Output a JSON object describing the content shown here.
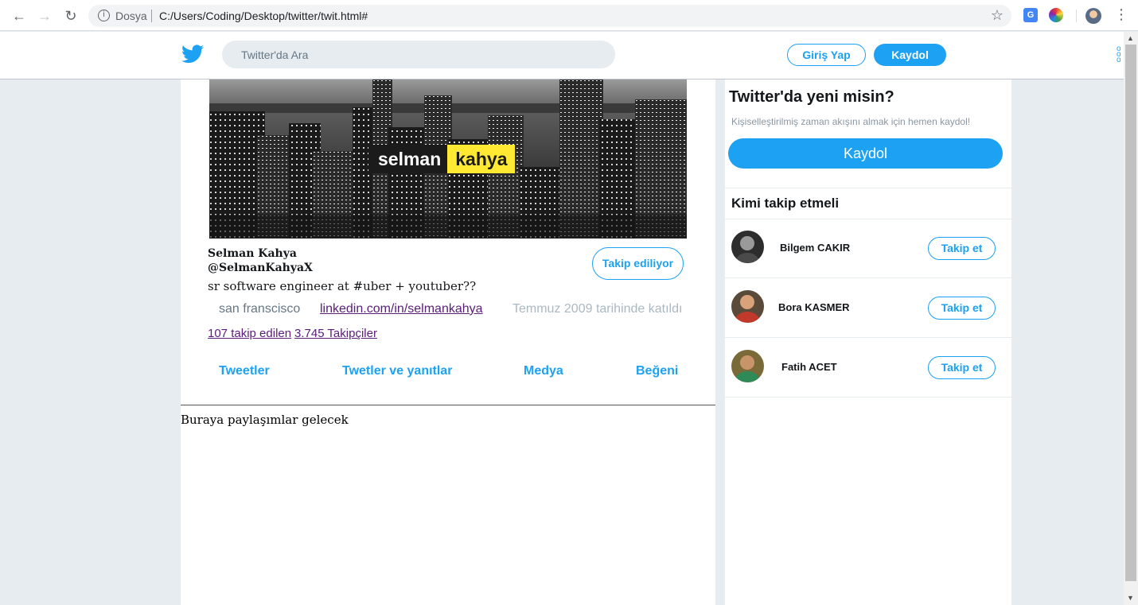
{
  "browser": {
    "site_label": "Dosya",
    "url": "C:/Users/Coding/Desktop/twitter/twit.html#"
  },
  "header": {
    "search_placeholder": "Twitter'da Ara",
    "login_label": "Giriş Yap",
    "signup_label": "Kaydol",
    "brand_color": "#1da1f2"
  },
  "banner": {
    "word_1": "selman",
    "word_2": "kahya",
    "accent_color": "#ffe933"
  },
  "profile": {
    "name": "Selman Kahya",
    "handle": "@SelmanKahyaX",
    "follow_state_label": "Takip ediliyor",
    "bio": "sr software engineer at #uber + youtuber??",
    "location": "san franscisco",
    "link": "linkedin.com/in/selmankahya",
    "joined": "Temmuz 2009 tarihinde katıldı",
    "following": "107 takip edilen",
    "followers": "3.745 Takipçiler"
  },
  "tabs": [
    {
      "label": "Tweetler"
    },
    {
      "label": "Twetler ve yanıtlar"
    },
    {
      "label": "Medya"
    },
    {
      "label": "Beğeni"
    }
  ],
  "feed": {
    "placeholder": "Buraya paylaşımlar gelecek"
  },
  "sidebar": {
    "title": "Twitter'da yeni misin?",
    "subtitle": "Kişiselleştirilmiş zaman akışını almak için hemen kaydol!",
    "signup_label": "Kaydol",
    "who_title": "Kimi takip etmeli",
    "suggestions": [
      {
        "name": "Bilgem CAKIR",
        "button": "Takip et"
      },
      {
        "name": "Bora KASMER",
        "button": "Takip et"
      },
      {
        "name": "Fatih ACET",
        "button": "Takip et"
      }
    ]
  }
}
